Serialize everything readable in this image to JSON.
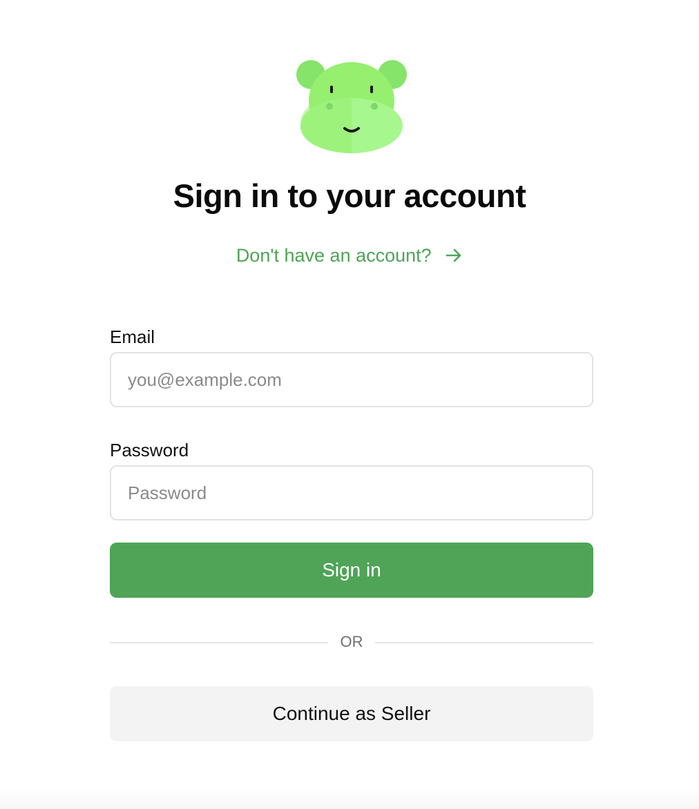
{
  "logo": {
    "icon": "hippo-logo-icon",
    "colors": {
      "head": "#96ef6f",
      "ears": "#86e46a",
      "snout": "#a6f78d",
      "nostrils": "#80d86a",
      "features": "#1a1a1a"
    }
  },
  "header": {
    "title": "Sign in to your account",
    "signup_link": "Don't have an account?",
    "signup_icon": "arrow-right-icon"
  },
  "form": {
    "email": {
      "label": "Email",
      "placeholder": "you@example.com",
      "value": ""
    },
    "password": {
      "label": "Password",
      "placeholder": "Password",
      "value": ""
    },
    "submit_label": "Sign in",
    "divider_text": "OR",
    "seller_label": "Continue as Seller"
  },
  "colors": {
    "accent": "#4fa457",
    "link": "#4ea456",
    "secondary_button": "#f3f3f3",
    "input_border": "#e2e2e2"
  }
}
